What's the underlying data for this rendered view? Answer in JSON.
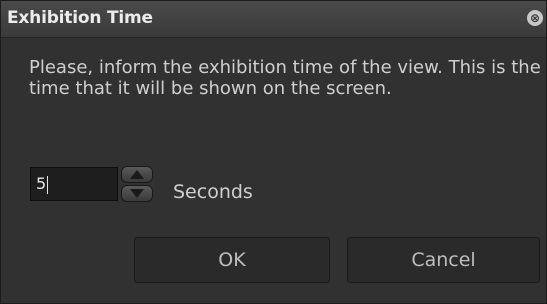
{
  "dialog": {
    "title": "Exhibition Time",
    "close_glyph": "⊗",
    "message": "Please, inform the exhibition time of the view. This is the time that it will be shown on the screen.",
    "time_value": "5",
    "unit_label": "Seconds",
    "ok_label": "OK",
    "cancel_label": "Cancel"
  },
  "icons": {
    "close": "close-icon",
    "spin_up": "arrow-up-icon",
    "spin_down": "arrow-down-icon"
  },
  "colors": {
    "background": "#313131",
    "titlebar": "#3a3a3a",
    "text": "#cfcfcf",
    "input_bg": "#1e1e1e"
  }
}
